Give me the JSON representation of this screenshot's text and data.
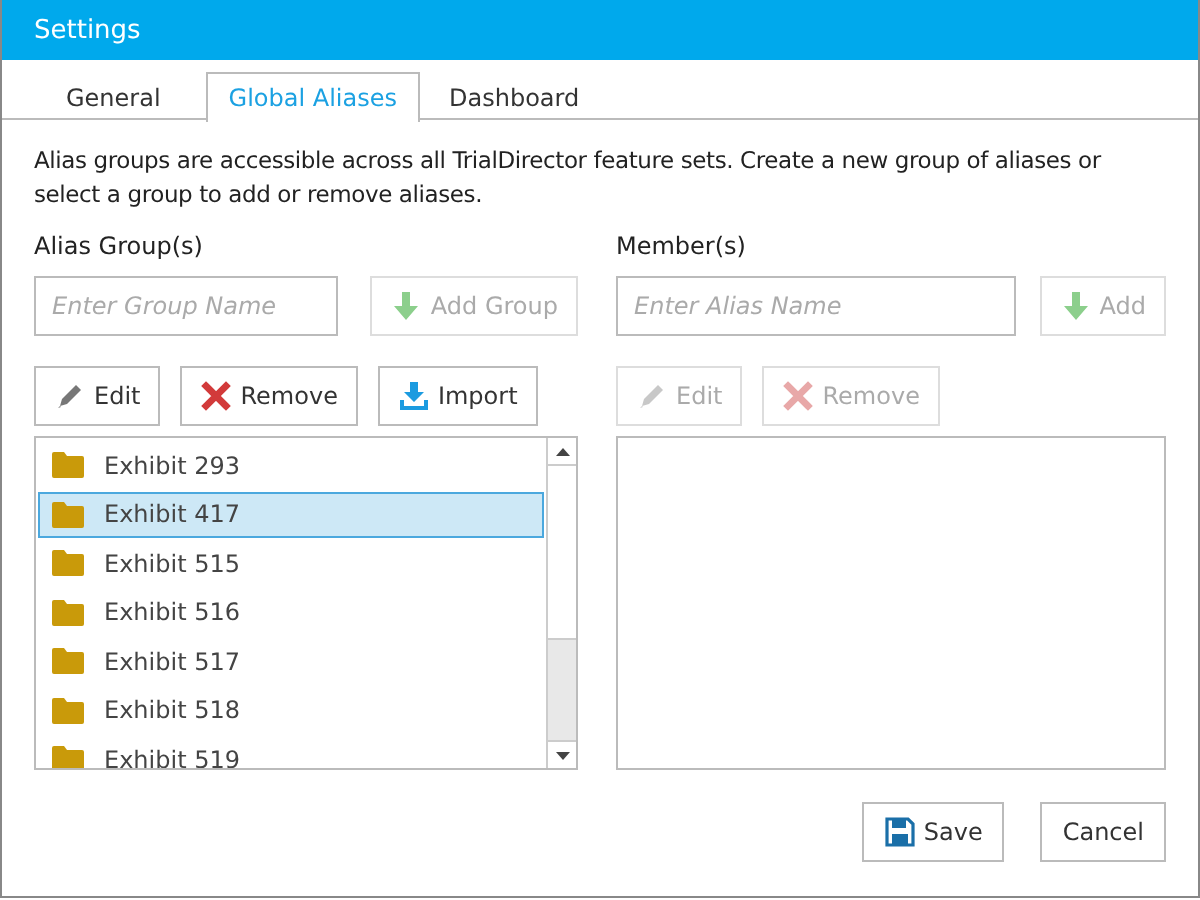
{
  "window": {
    "title": "Settings"
  },
  "tabs": [
    {
      "label": "General",
      "selected": false
    },
    {
      "label": "Global Aliases",
      "selected": true
    },
    {
      "label": "Dashboard",
      "selected": false
    }
  ],
  "description": "Alias groups are accessible across all TrialDirector feature sets. Create a new group of aliases or select a group to add or remove aliases.",
  "groups": {
    "label": "Alias Group(s)",
    "placeholder": "Enter Group Name",
    "add_button": {
      "label": "Add Group",
      "disabled": true
    },
    "buttons": [
      {
        "kind": "edit",
        "label": "Edit",
        "disabled": false
      },
      {
        "kind": "remove",
        "label": "Remove",
        "disabled": false
      },
      {
        "kind": "import",
        "label": "Import",
        "disabled": false
      }
    ],
    "items": [
      {
        "label": "Exhibit 293",
        "selected": false
      },
      {
        "label": "Exhibit 417",
        "selected": true
      },
      {
        "label": "Exhibit 515",
        "selected": false
      },
      {
        "label": "Exhibit 516",
        "selected": false
      },
      {
        "label": "Exhibit 517",
        "selected": false
      },
      {
        "label": "Exhibit 518",
        "selected": false
      },
      {
        "label": "Exhibit 519",
        "selected": false
      }
    ]
  },
  "members": {
    "label": "Member(s)",
    "placeholder": "Enter Alias Name",
    "add_button": {
      "label": "Add",
      "disabled": true
    },
    "buttons": [
      {
        "kind": "edit",
        "label": "Edit",
        "disabled": true
      },
      {
        "kind": "remove",
        "label": "Remove",
        "disabled": true
      }
    ]
  },
  "footer_buttons": [
    {
      "kind": "save",
      "label": "Save"
    },
    {
      "kind": "cancel",
      "label": "Cancel"
    }
  ]
}
